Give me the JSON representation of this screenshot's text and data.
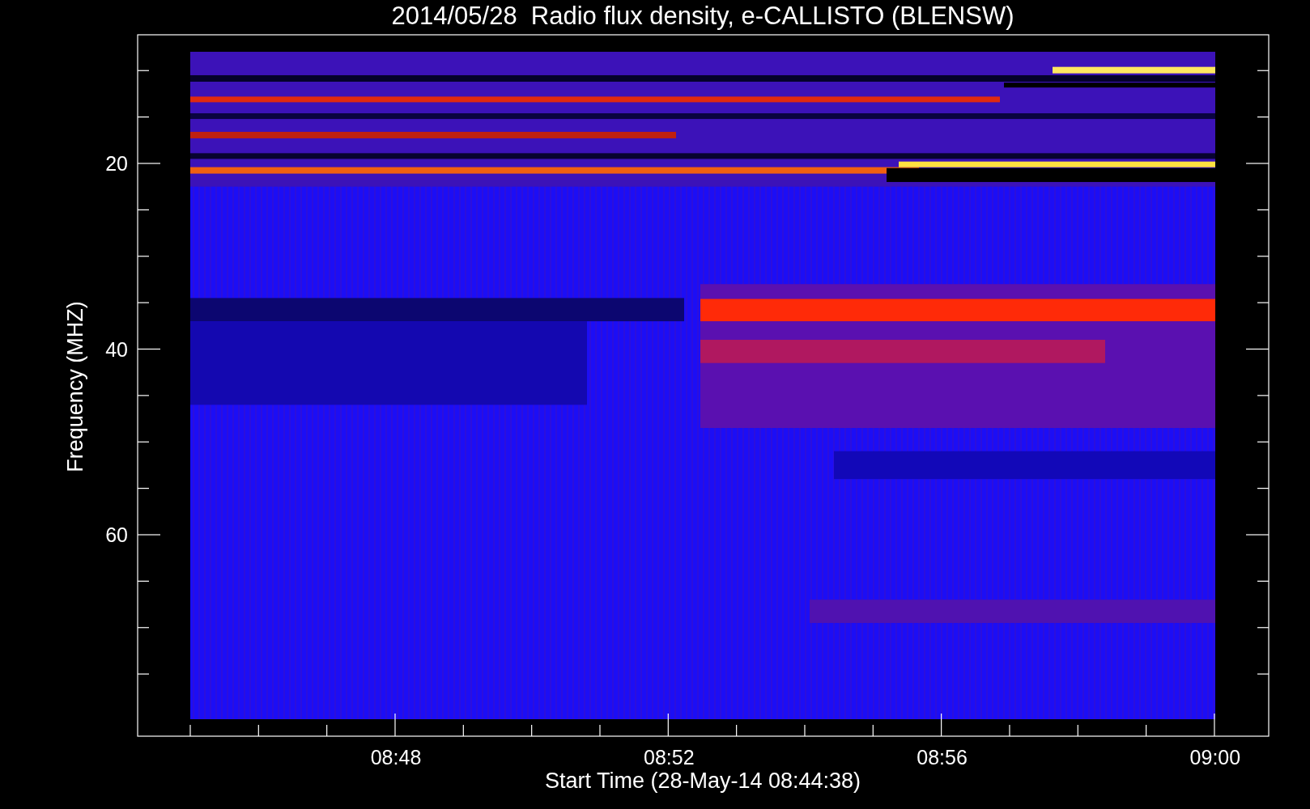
{
  "title": "2014/05/28  Radio flux density, e-CALLISTO (BLENSW)",
  "y_axis": {
    "label": "Frequency (MHZ)",
    "ticks": [
      "20",
      "40",
      "60"
    ]
  },
  "x_axis": {
    "label": "Start Time (28-May-14 08:44:38)",
    "ticks": [
      "08:48",
      "08:52",
      "08:56",
      "09:00"
    ]
  }
}
